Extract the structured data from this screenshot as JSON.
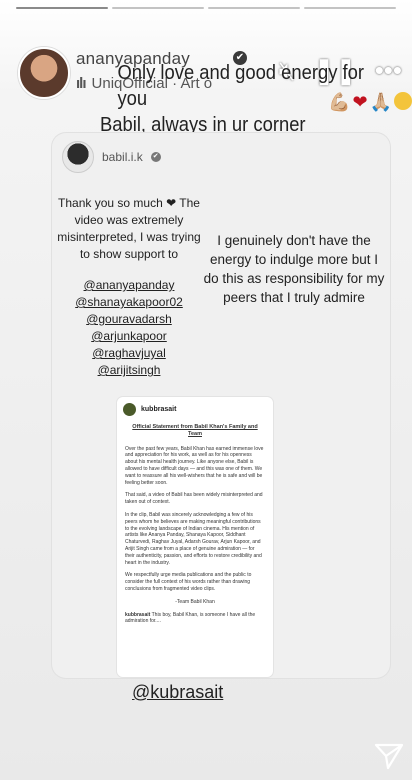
{
  "progress": {
    "segments": 4,
    "current": 0
  },
  "header": {
    "username": "ananyapanday",
    "verified_glyph": "✔",
    "audio_label": "UniqOfficial · Art o",
    "audio_icon": "equalizer-icon",
    "controls": [
      "mute-icon",
      "pause-icon",
      "more-icon"
    ]
  },
  "overlay_text": {
    "line1": "Only love and good energy for you",
    "line2": "Babil, always in ur corner",
    "emoji": [
      "💪🏼",
      "❤",
      "🙏🏼"
    ]
  },
  "card": {
    "username": "babil.i.k",
    "left_text": "Thank you so much ❤ The video was extremely misinterpreted, I was trying to show support to",
    "mentions": [
      "@ananyapanday",
      "@shanayakapoor02",
      "@gouravadarsh",
      "@arjunkapoor",
      "@raghavjuyal",
      "@arijitsingh"
    ],
    "right_text": "I genuinely don't have the energy to indulge more but I do this as responsibility for my peers that I truly admire"
  },
  "doc": {
    "username": "kubbrasait",
    "title": "Official Statement from Babil Khan's Family and Team",
    "paragraphs": [
      "Over the past few years, Babil Khan has earned immense love and appreciation for his work, as well as for his openness about his mental health journey. Like anyone else, Babil is allowed to have difficult days — and this was one of them. We want to reassure all his well-wishers that he is safe and will be feeling better soon.",
      "That said, a video of Babil has been widely misinterpreted and taken out of context.",
      "In the clip, Babil was sincerely acknowledging a few of his peers whom he believes are making meaningful contributions to the evolving landscape of Indian cinema. His mention of artists like Ananya Panday, Shanaya Kapoor, Siddhant Chaturvedi, Raghav Juyal, Adarsh Gourav, Arjun Kapoor, and Arijit Singh came from a place of genuine admiration — for their authenticity, passion, and efforts to restore credibility and heart in the industry.",
      "We respectfully urge media publications and the public to consider the full context of his words rather than drawing conclusions from fragmented video clips."
    ],
    "sign": "-Team Babil Khan",
    "caption_user": "kubbrasait",
    "caption_text": "This boy, Babil Khan, is someone I have all the admiration for...."
  },
  "footer_mention": "@kubrasait",
  "send_icon": "send-icon"
}
